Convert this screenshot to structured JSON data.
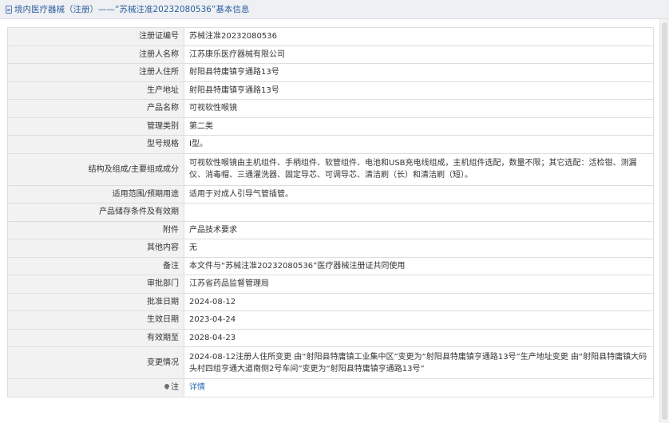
{
  "header": {
    "icon": "document-icon",
    "title": "境内医疗器械（注册）——“苏械注准20232080536”基本信息"
  },
  "rows": [
    {
      "label": "注册证编号",
      "value": "苏械注准20232080536"
    },
    {
      "label": "注册人名称",
      "value": "江苏康乐医疗器械有限公司"
    },
    {
      "label": "注册人住所",
      "value": "射阳县特庸镇亨通路13号"
    },
    {
      "label": "生产地址",
      "value": "射阳县特庸镇亨通路13号"
    },
    {
      "label": "产品名称",
      "value": "可视软性喉镜"
    },
    {
      "label": "管理类别",
      "value": "第二类"
    },
    {
      "label": "型号规格",
      "value": "I型。"
    },
    {
      "label": "结构及组成/主要组成成分",
      "value": "可视软性喉镜由主机组件、手柄组件、软管组件、电池和USB充电线组成，主机组件选配，数量不限；其它选配：活检钳、测漏仪、消毒帽、三通灌洗器、固定导芯、可调导芯、清洁刷（长）和清洁刷（短）。"
    },
    {
      "label": "适用范围/预期用途",
      "value": "适用于对成人引导气管插管。"
    },
    {
      "label": "产品储存条件及有效期",
      "value": ""
    },
    {
      "label": "附件",
      "value": "产品技术要求"
    },
    {
      "label": "其他内容",
      "value": "无"
    },
    {
      "label": "备注",
      "value": "本文件与“苏械注准20232080536”医疗器械注册证共同使用"
    },
    {
      "label": "审批部门",
      "value": "江苏省药品监督管理局"
    },
    {
      "label": "批准日期",
      "value": "2024-08-12"
    },
    {
      "label": "生效日期",
      "value": "2023-04-24"
    },
    {
      "label": "有效期至",
      "value": "2028-04-23"
    },
    {
      "label": "变更情况",
      "value": "2024-08-12注册人住所变更 由“射阳县特庸镇工业集中区”变更为“射阳县特庸镇亨通路13号”生产地址变更 由“射阳县特庸镇大码头村四组亨通大道南侧2号车间”变更为“射阳县特庸镇亨通路13号”"
    }
  ],
  "note": {
    "icon": "pin-icon",
    "label": "注",
    "link_text": "详情"
  },
  "colors": {
    "title": "#2c5f9e",
    "label_bg": "#f2f2f2",
    "border": "#dedede",
    "link": "#2c6bb8"
  }
}
